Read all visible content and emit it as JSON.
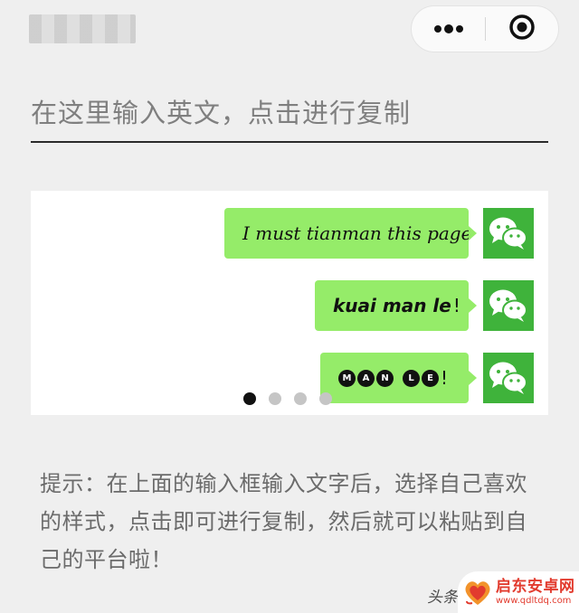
{
  "header": {
    "capsule": {
      "more_icon": "more-dots-icon",
      "close_icon": "target-circle-icon"
    }
  },
  "input": {
    "placeholder": "在这里输入英文，点击进行复制"
  },
  "carousel": {
    "slides": [
      {
        "text": "I must tianman this page",
        "style": "italic-serif"
      },
      {
        "text": "kuai man le",
        "suffix": "!",
        "style": "bold-italic"
      },
      {
        "letters": [
          "M",
          "A",
          "N",
          "L",
          "E"
        ],
        "suffix": "!",
        "style": "circled"
      }
    ],
    "pagination": {
      "count": 4,
      "active": 1
    },
    "avatar_icon": "wechat-icon",
    "colors": {
      "bubble": "#95ec69",
      "avatar": "#3fb33b"
    }
  },
  "hint": {
    "text": "提示：在上面的输入框输入文字后，选择自己喜欢的样式，点击即可进行复制，然后就可以粘贴到自己的平台啦！"
  },
  "watermark": {
    "left_label": "头条",
    "site_name": "启东安卓网",
    "site_url": "www.qdltdq.com",
    "logo_icon": "heart-logo-icon",
    "accent": "#e23b2e"
  }
}
